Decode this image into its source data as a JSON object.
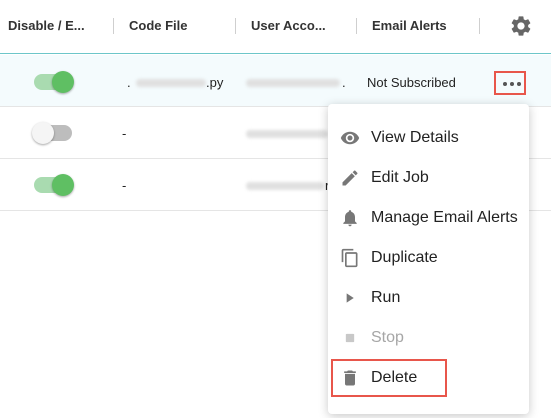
{
  "header": {
    "col_toggle": "Disable / E...",
    "col_code": "Code File",
    "col_user": "User Acco...",
    "col_email": "Email Alerts"
  },
  "rows": [
    {
      "enabled": true,
      "code_file": ".py",
      "code_prefix": ".",
      "user_suffix": ".",
      "email_alerts": "Not Subscribed"
    },
    {
      "enabled": false,
      "code_file": "-",
      "user_suffix": ""
    },
    {
      "enabled": true,
      "code_file": "-",
      "user_suffix": "r"
    }
  ],
  "menu": {
    "items": [
      {
        "label": "View Details",
        "icon": "eye-icon",
        "enabled": true
      },
      {
        "label": "Edit Job",
        "icon": "pencil-icon",
        "enabled": true
      },
      {
        "label": "Manage Email Alerts",
        "icon": "bell-icon",
        "enabled": true
      },
      {
        "label": "Duplicate",
        "icon": "copy-icon",
        "enabled": true
      },
      {
        "label": "Run",
        "icon": "play-icon",
        "enabled": true
      },
      {
        "label": "Stop",
        "icon": "stop-icon",
        "enabled": false
      },
      {
        "label": "Delete",
        "icon": "trash-icon",
        "enabled": true
      }
    ]
  },
  "colors": {
    "toggle_on_track": "#a9dbb0",
    "toggle_on_knob": "#5fbf63",
    "highlight": "#e8564b",
    "header_border": "#6cc6c9"
  }
}
